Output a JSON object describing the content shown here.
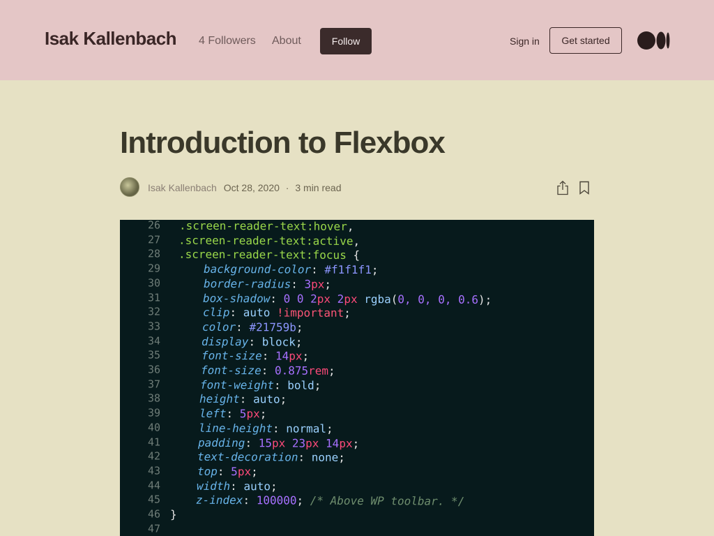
{
  "header": {
    "publication_name": "Isak Kallenbach",
    "followers": "4 Followers",
    "about": "About",
    "follow": "Follow",
    "sign_in": "Sign in",
    "get_started": "Get started",
    "logo_icon": "medium-logo-icon"
  },
  "article": {
    "title": "Introduction to Flexbox",
    "author": "Isak Kallenbach",
    "date": "Oct 28, 2020",
    "separator": "·",
    "read_time": "3 min read",
    "share_icon": "share-icon",
    "bookmark_icon": "bookmark-icon"
  },
  "hero_code": {
    "lines": [
      {
        "n": "26",
        "parts": [
          {
            "t": ".screen-reader-text:hover",
            "c": "sel"
          },
          {
            "t": ",",
            "c": "punc"
          }
        ]
      },
      {
        "n": "27",
        "parts": [
          {
            "t": ".screen-reader-text:active",
            "c": "sel"
          },
          {
            "t": ",",
            "c": "punc"
          }
        ]
      },
      {
        "n": "28",
        "parts": [
          {
            "t": ".screen-reader-text:focus ",
            "c": "sel"
          },
          {
            "t": "{",
            "c": "punc"
          }
        ]
      },
      {
        "n": "29",
        "parts": [
          {
            "t": "background-color",
            "c": "prop"
          },
          {
            "t": ": ",
            "c": "punc"
          },
          {
            "t": "#f1f1f1",
            "c": "val"
          },
          {
            "t": ";",
            "c": "punc"
          }
        ]
      },
      {
        "n": "30",
        "parts": [
          {
            "t": "border-radius",
            "c": "prop"
          },
          {
            "t": ": ",
            "c": "punc"
          },
          {
            "t": "3",
            "c": "num"
          },
          {
            "t": "px",
            "c": "unit"
          },
          {
            "t": ";",
            "c": "punc"
          }
        ]
      },
      {
        "n": "31",
        "parts": [
          {
            "t": "box-shadow",
            "c": "prop"
          },
          {
            "t": ": ",
            "c": "punc"
          },
          {
            "t": "0 0 2",
            "c": "num"
          },
          {
            "t": "px ",
            "c": "unit"
          },
          {
            "t": "2",
            "c": "num"
          },
          {
            "t": "px ",
            "c": "unit"
          },
          {
            "t": "rgba",
            "c": "kw"
          },
          {
            "t": "(",
            "c": "punc"
          },
          {
            "t": "0, 0, 0, 0.6",
            "c": "num"
          },
          {
            "t": ");",
            "c": "punc"
          }
        ]
      },
      {
        "n": "32",
        "parts": [
          {
            "t": "clip",
            "c": "prop"
          },
          {
            "t": ": ",
            "c": "punc"
          },
          {
            "t": "auto ",
            "c": "kw"
          },
          {
            "t": "!important",
            "c": "imp"
          },
          {
            "t": ";",
            "c": "punc"
          }
        ]
      },
      {
        "n": "33",
        "parts": [
          {
            "t": "color",
            "c": "prop"
          },
          {
            "t": ": ",
            "c": "punc"
          },
          {
            "t": "#21759b",
            "c": "val"
          },
          {
            "t": ";",
            "c": "punc"
          }
        ]
      },
      {
        "n": "34",
        "parts": [
          {
            "t": "display",
            "c": "prop"
          },
          {
            "t": ": ",
            "c": "punc"
          },
          {
            "t": "block",
            "c": "kw"
          },
          {
            "t": ";",
            "c": "punc"
          }
        ]
      },
      {
        "n": "35",
        "parts": [
          {
            "t": "font-size",
            "c": "prop"
          },
          {
            "t": ": ",
            "c": "punc"
          },
          {
            "t": "14",
            "c": "num"
          },
          {
            "t": "px",
            "c": "unit"
          },
          {
            "t": ";",
            "c": "punc"
          }
        ]
      },
      {
        "n": "36",
        "parts": [
          {
            "t": "font-size",
            "c": "prop"
          },
          {
            "t": ": ",
            "c": "punc"
          },
          {
            "t": "0.875",
            "c": "num"
          },
          {
            "t": "rem",
            "c": "unit"
          },
          {
            "t": ";",
            "c": "punc"
          }
        ]
      },
      {
        "n": "37",
        "parts": [
          {
            "t": "font-weight",
            "c": "prop"
          },
          {
            "t": ": ",
            "c": "punc"
          },
          {
            "t": "bold",
            "c": "kw"
          },
          {
            "t": ";",
            "c": "punc"
          }
        ]
      },
      {
        "n": "38",
        "parts": [
          {
            "t": "height",
            "c": "prop"
          },
          {
            "t": ": ",
            "c": "punc"
          },
          {
            "t": "auto",
            "c": "kw"
          },
          {
            "t": ";",
            "c": "punc"
          }
        ]
      },
      {
        "n": "39",
        "parts": [
          {
            "t": "left",
            "c": "prop"
          },
          {
            "t": ": ",
            "c": "punc"
          },
          {
            "t": "5",
            "c": "num"
          },
          {
            "t": "px",
            "c": "unit"
          },
          {
            "t": ";",
            "c": "punc"
          }
        ]
      },
      {
        "n": "40",
        "parts": [
          {
            "t": "line-height",
            "c": "prop"
          },
          {
            "t": ": ",
            "c": "punc"
          },
          {
            "t": "normal",
            "c": "kw"
          },
          {
            "t": ";",
            "c": "punc"
          }
        ]
      },
      {
        "n": "41",
        "parts": [
          {
            "t": "padding",
            "c": "prop"
          },
          {
            "t": ": ",
            "c": "punc"
          },
          {
            "t": "15",
            "c": "num"
          },
          {
            "t": "px ",
            "c": "unit"
          },
          {
            "t": "23",
            "c": "num"
          },
          {
            "t": "px ",
            "c": "unit"
          },
          {
            "t": "14",
            "c": "num"
          },
          {
            "t": "px",
            "c": "unit"
          },
          {
            "t": ";",
            "c": "punc"
          }
        ]
      },
      {
        "n": "42",
        "parts": [
          {
            "t": "text-decoration",
            "c": "prop"
          },
          {
            "t": ": ",
            "c": "punc"
          },
          {
            "t": "none",
            "c": "kw"
          },
          {
            "t": ";",
            "c": "punc"
          }
        ]
      },
      {
        "n": "43",
        "parts": [
          {
            "t": "top",
            "c": "prop"
          },
          {
            "t": ": ",
            "c": "punc"
          },
          {
            "t": "5",
            "c": "num"
          },
          {
            "t": "px",
            "c": "unit"
          },
          {
            "t": ";",
            "c": "punc"
          }
        ]
      },
      {
        "n": "44",
        "parts": [
          {
            "t": "width",
            "c": "prop"
          },
          {
            "t": ": ",
            "c": "punc"
          },
          {
            "t": "auto",
            "c": "kw"
          },
          {
            "t": ";",
            "c": "punc"
          }
        ]
      },
      {
        "n": "45",
        "parts": [
          {
            "t": "z-index",
            "c": "prop"
          },
          {
            "t": ": ",
            "c": "punc"
          },
          {
            "t": "100000",
            "c": "num"
          },
          {
            "t": "; ",
            "c": "punc"
          },
          {
            "t": "/* Above WP toolbar. */",
            "c": "cmt"
          }
        ]
      },
      {
        "n": "46",
        "parts": [
          {
            "t": "}",
            "c": "punc"
          }
        ]
      },
      {
        "n": "47",
        "parts": []
      }
    ]
  }
}
